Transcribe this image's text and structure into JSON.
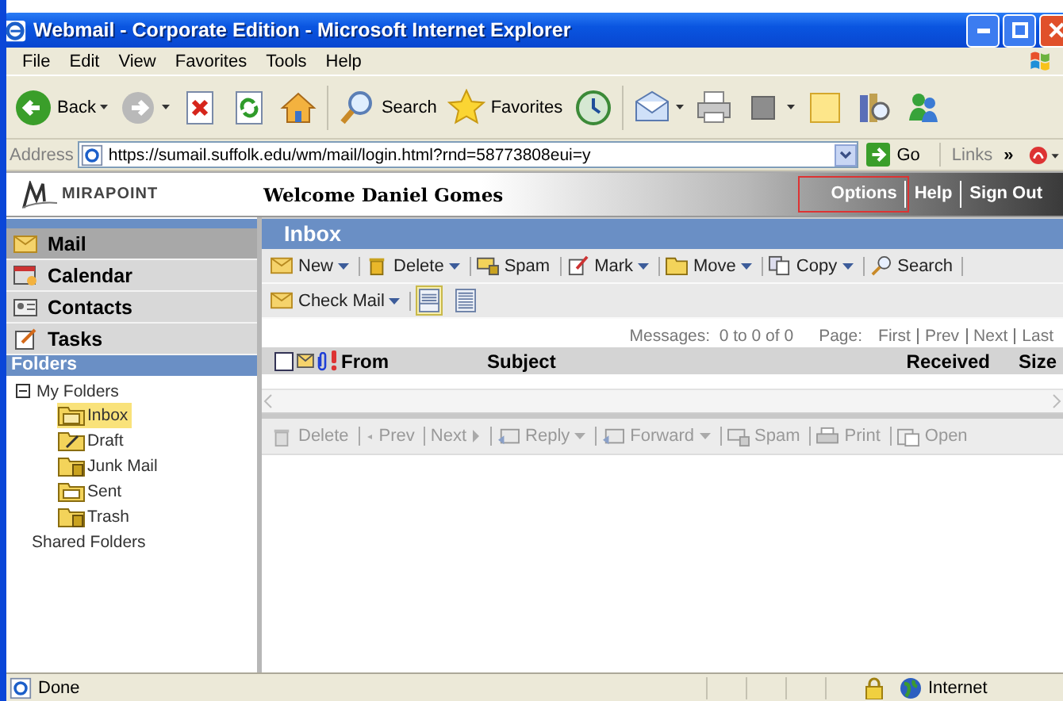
{
  "window": {
    "title": "Webmail - Corporate Edition - Microsoft Internet Explorer"
  },
  "menu": [
    "File",
    "Edit",
    "View",
    "Favorites",
    "Tools",
    "Help"
  ],
  "browser_toolbar": [
    {
      "kind": "back",
      "label": "Back",
      "dropdown": true
    },
    {
      "kind": "forward",
      "dropdown": true
    },
    {
      "kind": "stop"
    },
    {
      "kind": "refresh"
    },
    {
      "kind": "home"
    },
    {
      "kind": "search",
      "label": "Search"
    },
    {
      "kind": "favorites",
      "label": "Favorites"
    },
    {
      "kind": "history"
    },
    {
      "kind": "mail",
      "dropdown": true
    },
    {
      "kind": "print"
    },
    {
      "kind": "edit",
      "dropdown": true
    },
    {
      "kind": "note"
    },
    {
      "kind": "research"
    },
    {
      "kind": "messenger"
    }
  ],
  "address": {
    "label": "Address",
    "value": "https://sumail.suffolk.edu/wm/mail/login.html?rnd=58773808eui=y",
    "go": "Go",
    "links": "Links",
    "more": "»"
  },
  "header": {
    "logo": "MIRAPOINT",
    "welcome": "Welcome Daniel Gomes",
    "links": [
      {
        "label": "Options",
        "annotated": true
      },
      {
        "label": "Help",
        "annotated": false
      },
      {
        "label": "Sign Out",
        "annotated": false
      }
    ]
  },
  "nav": [
    {
      "kind": "mail",
      "label": "Mail",
      "selected": true
    },
    {
      "kind": "calendar",
      "label": "Calendar",
      "selected": false
    },
    {
      "kind": "contacts",
      "label": "Contacts",
      "selected": false
    },
    {
      "kind": "tasks",
      "label": "Tasks",
      "selected": false
    }
  ],
  "folders": {
    "title": "Folders",
    "tree": {
      "label": "My Folders",
      "expanded": true,
      "children": [
        {
          "kind": "inbox",
          "label": "Inbox",
          "selected": true
        },
        {
          "kind": "draft",
          "label": "Draft",
          "selected": false
        },
        {
          "kind": "junk",
          "label": "Junk Mail",
          "selected": false
        },
        {
          "kind": "sent",
          "label": "Sent",
          "selected": false
        },
        {
          "kind": "trash",
          "label": "Trash",
          "selected": false
        }
      ]
    },
    "shared": "Shared Folders"
  },
  "inbox": {
    "title": "Inbox",
    "toolbar": [
      {
        "kind": "new",
        "label": "New",
        "dropdown": true
      },
      {
        "kind": "delete",
        "label": "Delete",
        "dropdown": true
      },
      {
        "kind": "spam",
        "label": "Spam",
        "dropdown": false
      },
      {
        "kind": "mark",
        "label": "Mark",
        "dropdown": true
      },
      {
        "kind": "move",
        "label": "Move",
        "dropdown": true
      },
      {
        "kind": "copy",
        "label": "Copy",
        "dropdown": true
      },
      {
        "kind": "search",
        "label": "Search",
        "dropdown": false
      }
    ],
    "check_mail": {
      "label": "Check Mail",
      "dropdown": true
    },
    "views": [
      {
        "kind": "split",
        "selected": true
      },
      {
        "kind": "list",
        "selected": false
      }
    ],
    "messages": "Messages:  0 to 0 of 0",
    "page_label": "Page:",
    "pages": [
      "First",
      "Prev",
      "Next",
      "Last"
    ],
    "select_all": {
      "checked": false
    },
    "columns": [
      "From",
      "Subject",
      "Received",
      "Size"
    ],
    "reading_toolbar": [
      {
        "kind": "delete",
        "label": "Delete",
        "dropdown": false,
        "disabled": true
      },
      {
        "kind": "prev",
        "label": "Prev",
        "dropdown": false,
        "disabled": true
      },
      {
        "kind": "next",
        "label": "Next",
        "dropdown": false,
        "disabled": true
      },
      {
        "kind": "reply",
        "label": "Reply",
        "dropdown": true,
        "disabled": true
      },
      {
        "kind": "forward",
        "label": "Forward",
        "dropdown": true,
        "disabled": true
      },
      {
        "kind": "spam",
        "label": "Spam",
        "dropdown": false,
        "disabled": true
      },
      {
        "kind": "print",
        "label": "Print",
        "dropdown": false,
        "disabled": true
      },
      {
        "kind": "open",
        "label": "Open",
        "dropdown": false,
        "disabled": true
      }
    ]
  },
  "status_bar": {
    "text": "Done",
    "zone": "Internet"
  }
}
